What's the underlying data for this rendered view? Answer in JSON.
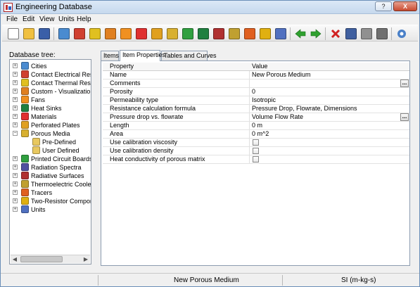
{
  "window": {
    "title": "Engineering Database",
    "help_label": "?",
    "close_label": "X"
  },
  "menu": [
    "File",
    "Edit",
    "View",
    "Units",
    "Help"
  ],
  "toolbar": {
    "buttons": [
      {
        "icon": "new-document-icon",
        "color": "#ffffff"
      },
      {
        "icon": "open-folder-icon",
        "color": "#f0c040"
      },
      {
        "icon": "save-icon",
        "color": "#3a5fa8"
      },
      {
        "icon": "globe-icon",
        "color": "#4a8bd0"
      },
      {
        "icon": "contact-resistance-icon",
        "color": "#d04030"
      },
      {
        "icon": "thermal-resistance-icon",
        "color": "#e0c020"
      },
      {
        "icon": "visualization-icon",
        "color": "#e08020"
      },
      {
        "icon": "fan-icon",
        "color": "#f09020"
      },
      {
        "icon": "materials-icon",
        "color": "#e03030"
      },
      {
        "icon": "perforated-plate-icon",
        "color": "#e0a020"
      },
      {
        "icon": "porous-media-icon",
        "color": "#d8b030"
      },
      {
        "icon": "pcb-icon",
        "color": "#30a040"
      },
      {
        "icon": "heat-sink-icon",
        "color": "#208040"
      },
      {
        "icon": "radiative-surface-icon",
        "color": "#b03030"
      },
      {
        "icon": "thermoelectric-icon",
        "color": "#c0a030"
      },
      {
        "icon": "tracer-icon",
        "color": "#e06020"
      },
      {
        "icon": "two-resistor-icon",
        "color": "#e0b010"
      },
      {
        "icon": "units-icon",
        "color": "#5070c0"
      },
      {
        "icon": "arrow-left-icon",
        "color": "#2fa02f"
      },
      {
        "icon": "arrow-right-icon",
        "color": "#2fa02f"
      },
      {
        "icon": "delete-icon",
        "color": "#d02020"
      },
      {
        "icon": "cut-icon",
        "color": "#4060a0"
      },
      {
        "icon": "copy-icon",
        "color": "#909090"
      },
      {
        "icon": "paste-icon",
        "color": "#707070"
      },
      {
        "icon": "settings-gear-icon",
        "color": "#4a80c8"
      }
    ]
  },
  "tree": {
    "label": "Database tree:",
    "items": [
      {
        "label": "Cities",
        "icon": "globe-icon",
        "color": "#4a8bd0",
        "level": 0
      },
      {
        "label": "Contact Electrical Resistance",
        "icon": "contact-resistance-icon",
        "color": "#d04030",
        "level": 0
      },
      {
        "label": "Contact Thermal Resistance",
        "icon": "thermal-resistance-icon",
        "color": "#e0c020",
        "level": 0
      },
      {
        "label": "Custom - Visualization Parameters",
        "icon": "visualization-icon",
        "color": "#e08020",
        "level": 0
      },
      {
        "label": "Fans",
        "icon": "fan-icon",
        "color": "#f09020",
        "level": 0
      },
      {
        "label": "Heat Sinks",
        "icon": "heat-sink-icon",
        "color": "#208040",
        "level": 0
      },
      {
        "label": "Materials",
        "icon": "materials-icon",
        "color": "#e03030",
        "level": 0
      },
      {
        "label": "Perforated Plates",
        "icon": "perforated-plate-icon",
        "color": "#e0a020",
        "level": 0
      },
      {
        "label": "Porous Media",
        "icon": "porous-media-icon",
        "color": "#d8b030",
        "level": 0
      },
      {
        "label": "Pre-Defined",
        "icon": "folder-icon",
        "color": "#e8c860",
        "level": 1
      },
      {
        "label": "User Defined",
        "icon": "folder-icon",
        "color": "#e8c860",
        "level": 1
      },
      {
        "label": "Printed Circuit Boards",
        "icon": "pcb-icon",
        "color": "#30a040",
        "level": 0
      },
      {
        "label": "Radiation Spectra",
        "icon": "radiation-spectra-icon",
        "color": "#5050a0",
        "level": 0
      },
      {
        "label": "Radiative Surfaces",
        "icon": "radiative-surface-icon",
        "color": "#b03030",
        "level": 0
      },
      {
        "label": "Thermoelectric Coolers",
        "icon": "thermoelectric-icon",
        "color": "#c0a030",
        "level": 0
      },
      {
        "label": "Tracers",
        "icon": "tracer-icon",
        "color": "#e06020",
        "level": 0
      },
      {
        "label": "Two-Resistor Components",
        "icon": "two-resistor-icon",
        "color": "#e0b010",
        "level": 0
      },
      {
        "label": "Units",
        "icon": "units-icon",
        "color": "#5070c0",
        "level": 0
      }
    ],
    "expander_plus": "+",
    "expander_minus": "−"
  },
  "tabs": [
    "Items",
    "Item Properties",
    "Tables and Curves"
  ],
  "properties": {
    "header": {
      "property": "Property",
      "value": "Value"
    },
    "rows": [
      {
        "property": "Name",
        "value": "New Porous Medium",
        "kind": "text"
      },
      {
        "property": "Comments",
        "value": "",
        "kind": "button"
      },
      {
        "property": "Porosity",
        "value": "0",
        "kind": "text"
      },
      {
        "property": "Permeability type",
        "value": "Isotropic",
        "kind": "text"
      },
      {
        "property": "Resistance calculation formula",
        "value": "Pressure Drop, Flowrate, Dimensions",
        "kind": "text"
      },
      {
        "property": "Pressure drop vs. flowrate",
        "value": "Volume Flow Rate",
        "kind": "button"
      },
      {
        "property": "Length",
        "value": "0 m",
        "kind": "text"
      },
      {
        "property": "Area",
        "value": "0 m^2",
        "kind": "text"
      },
      {
        "property": "Use calibration viscosity",
        "value": "",
        "kind": "checkbox"
      },
      {
        "property": "Use calibration density",
        "value": "",
        "kind": "checkbox"
      },
      {
        "property": "Heat conductivity of porous matrix",
        "value": "",
        "kind": "checkbox"
      }
    ],
    "ellipsis": "..."
  },
  "status": {
    "center": "New Porous Medium",
    "units": "SI (m-kg-s)"
  }
}
